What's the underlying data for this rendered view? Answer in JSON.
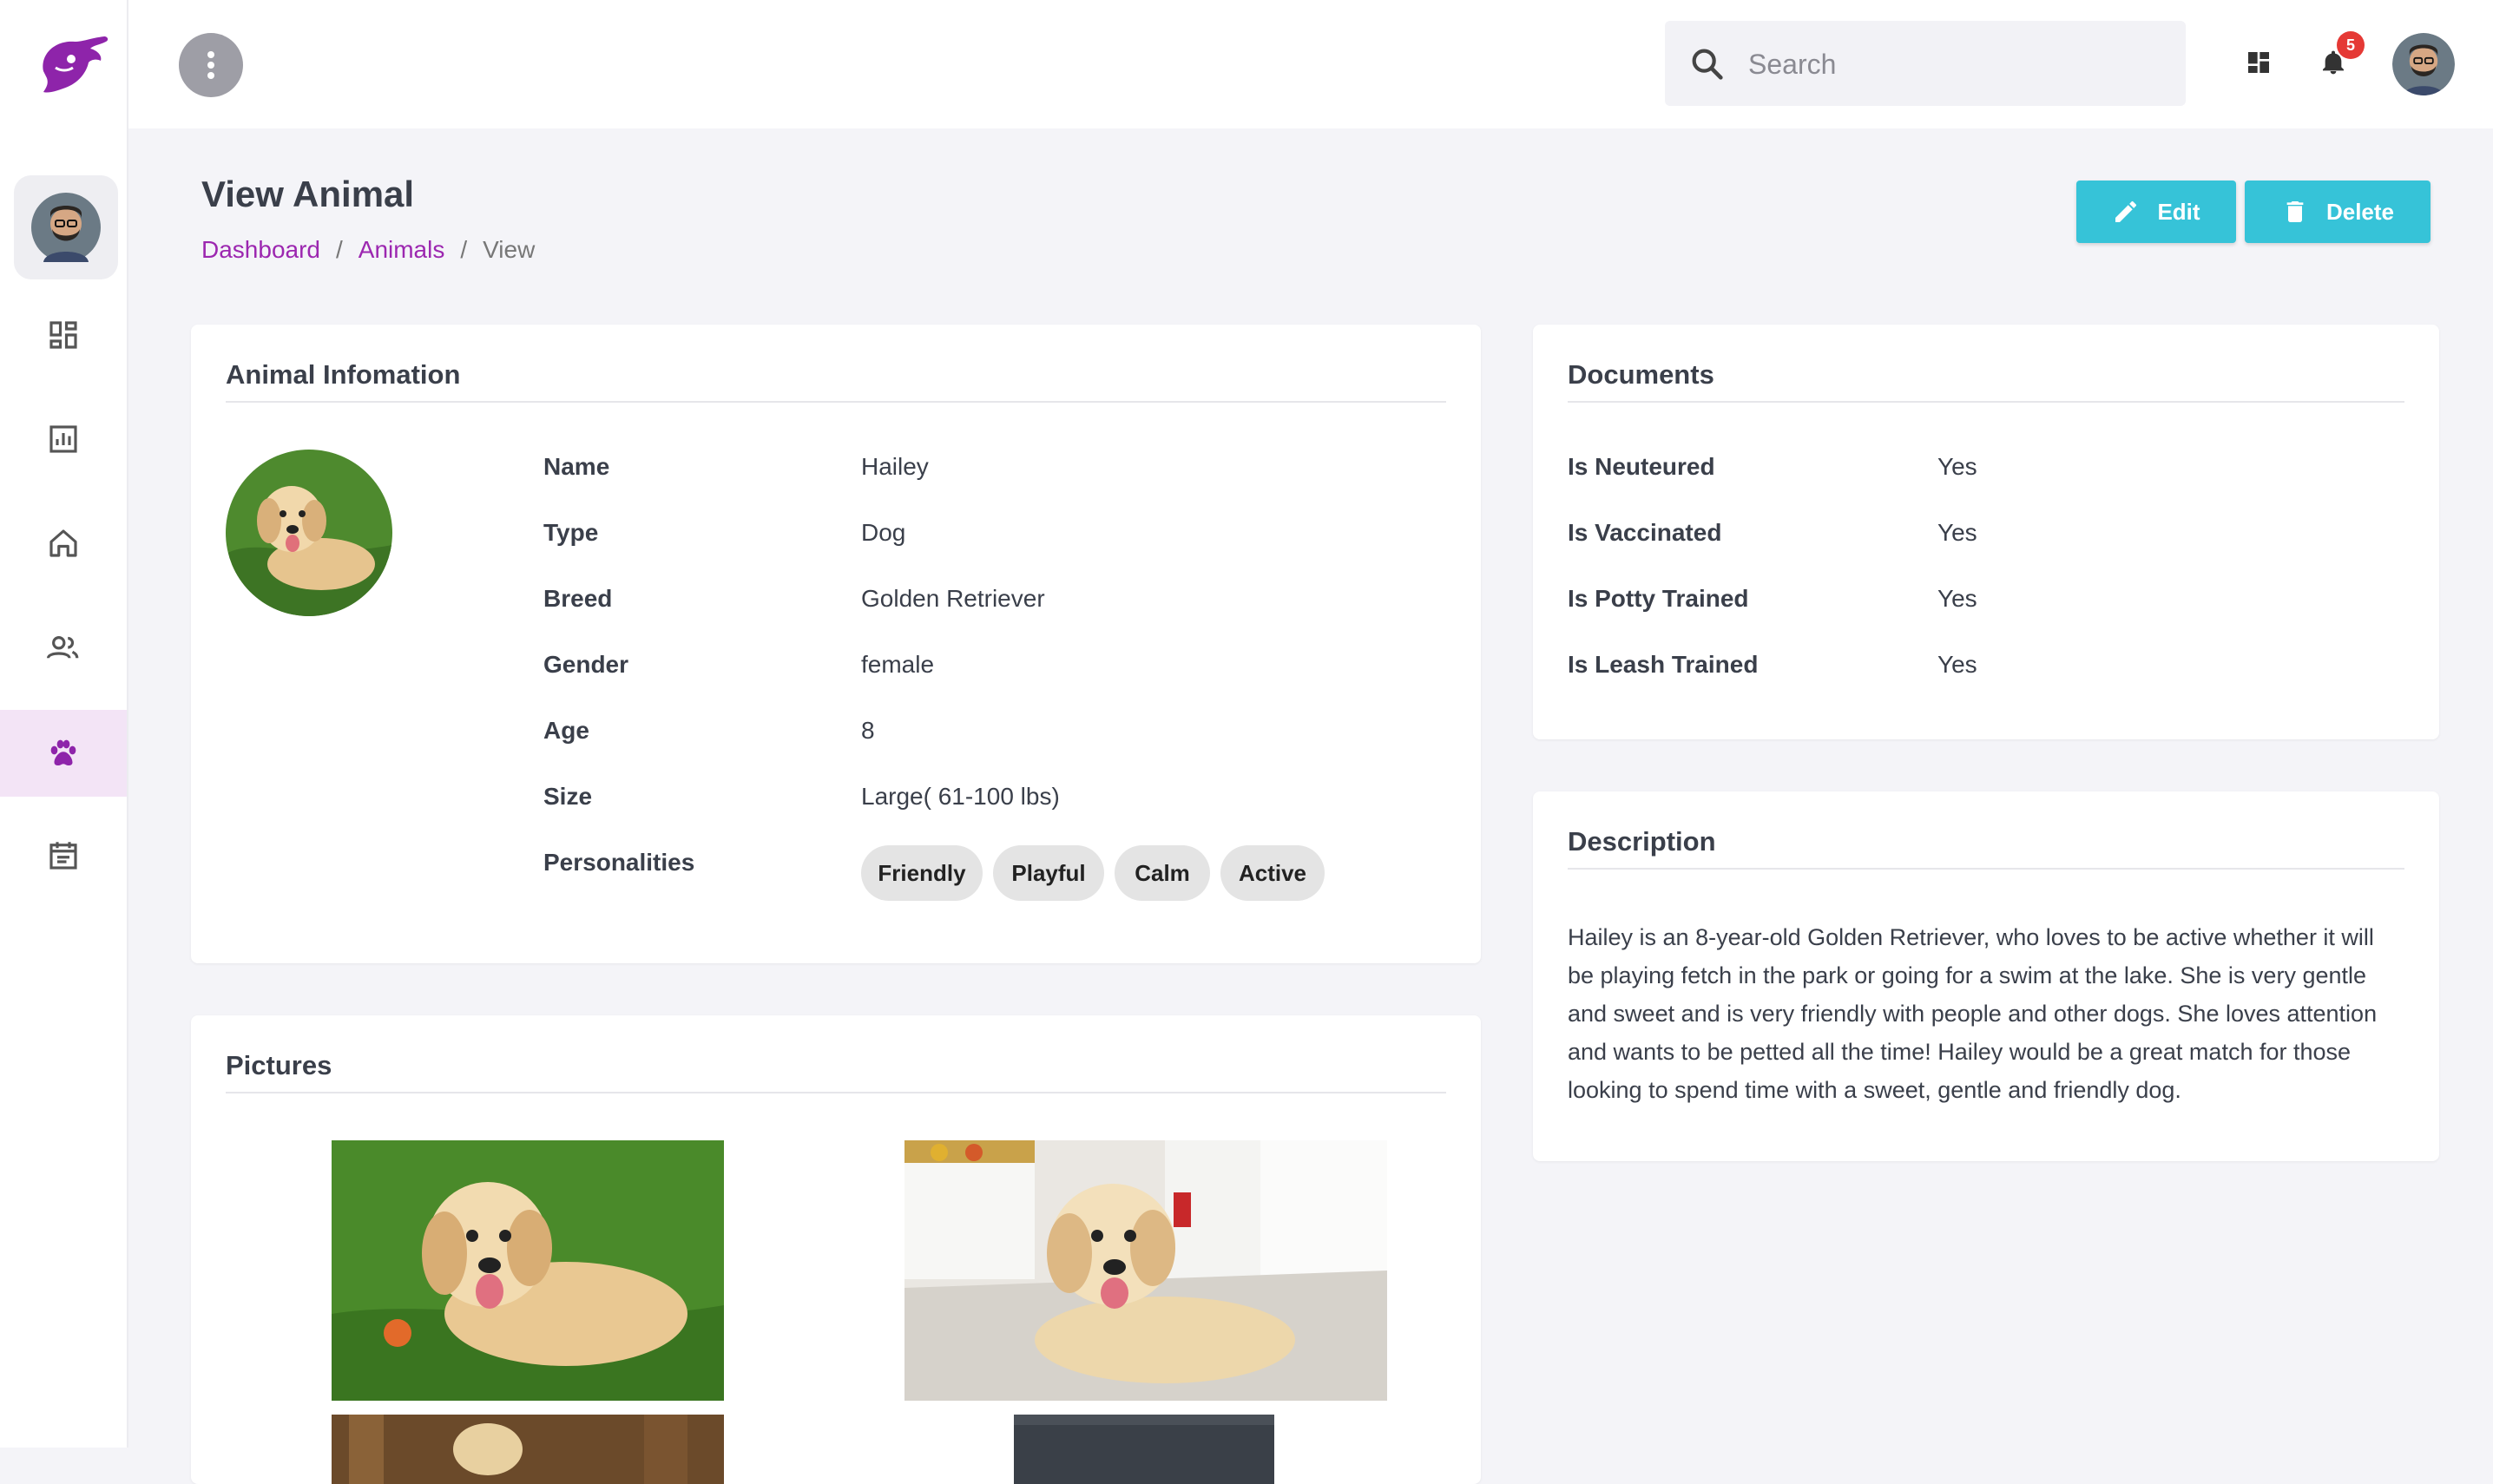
{
  "header": {
    "search_placeholder": "Search",
    "notification_count": "5"
  },
  "page": {
    "title": "View Animal",
    "breadcrumb": [
      "Dashboard",
      "Animals",
      "View"
    ],
    "edit_label": "Edit",
    "delete_label": "Delete"
  },
  "sidebar": {
    "items": [
      {
        "icon": "dashboard-icon"
      },
      {
        "icon": "analytics-icon"
      },
      {
        "icon": "home-icon"
      },
      {
        "icon": "people-icon"
      },
      {
        "icon": "paw-icon",
        "active": true
      },
      {
        "icon": "calendar-icon"
      }
    ]
  },
  "animal_info": {
    "title": "Animal Infomation",
    "rows": [
      {
        "label": "Name",
        "value": "Hailey"
      },
      {
        "label": "Type",
        "value": "Dog"
      },
      {
        "label": "Breed",
        "value": "Golden Retriever"
      },
      {
        "label": "Gender",
        "value": "female"
      },
      {
        "label": "Age",
        "value": "8"
      },
      {
        "label": "Size",
        "value": "Large( 61-100 lbs)"
      }
    ],
    "personalities_label": "Personalities",
    "personalities": [
      "Friendly",
      "Playful",
      "Calm",
      "Active"
    ]
  },
  "documents": {
    "title": "Documents",
    "rows": [
      {
        "label": "Is Neuteured",
        "value": "Yes"
      },
      {
        "label": "Is Vaccinated",
        "value": "Yes"
      },
      {
        "label": "Is Potty Trained",
        "value": "Yes"
      },
      {
        "label": "Is Leash Trained",
        "value": "Yes"
      }
    ]
  },
  "description": {
    "title": "Description",
    "text": "Hailey is an 8-year-old Golden Retriever, who loves to be active whether it will be playing fetch in the park or going for a swim at the lake. She is very gentle and sweet and is very friendly with people and other dogs. She loves attention and wants to be petted all the time! Hailey would be a great match for those looking to spend time with a sweet, gentle and friendly dog."
  },
  "pictures": {
    "title": "Pictures"
  },
  "colors": {
    "brand": "#8e24aa",
    "accent": "#36c3d8",
    "link": "#9c27b0",
    "badge": "#e53935"
  }
}
